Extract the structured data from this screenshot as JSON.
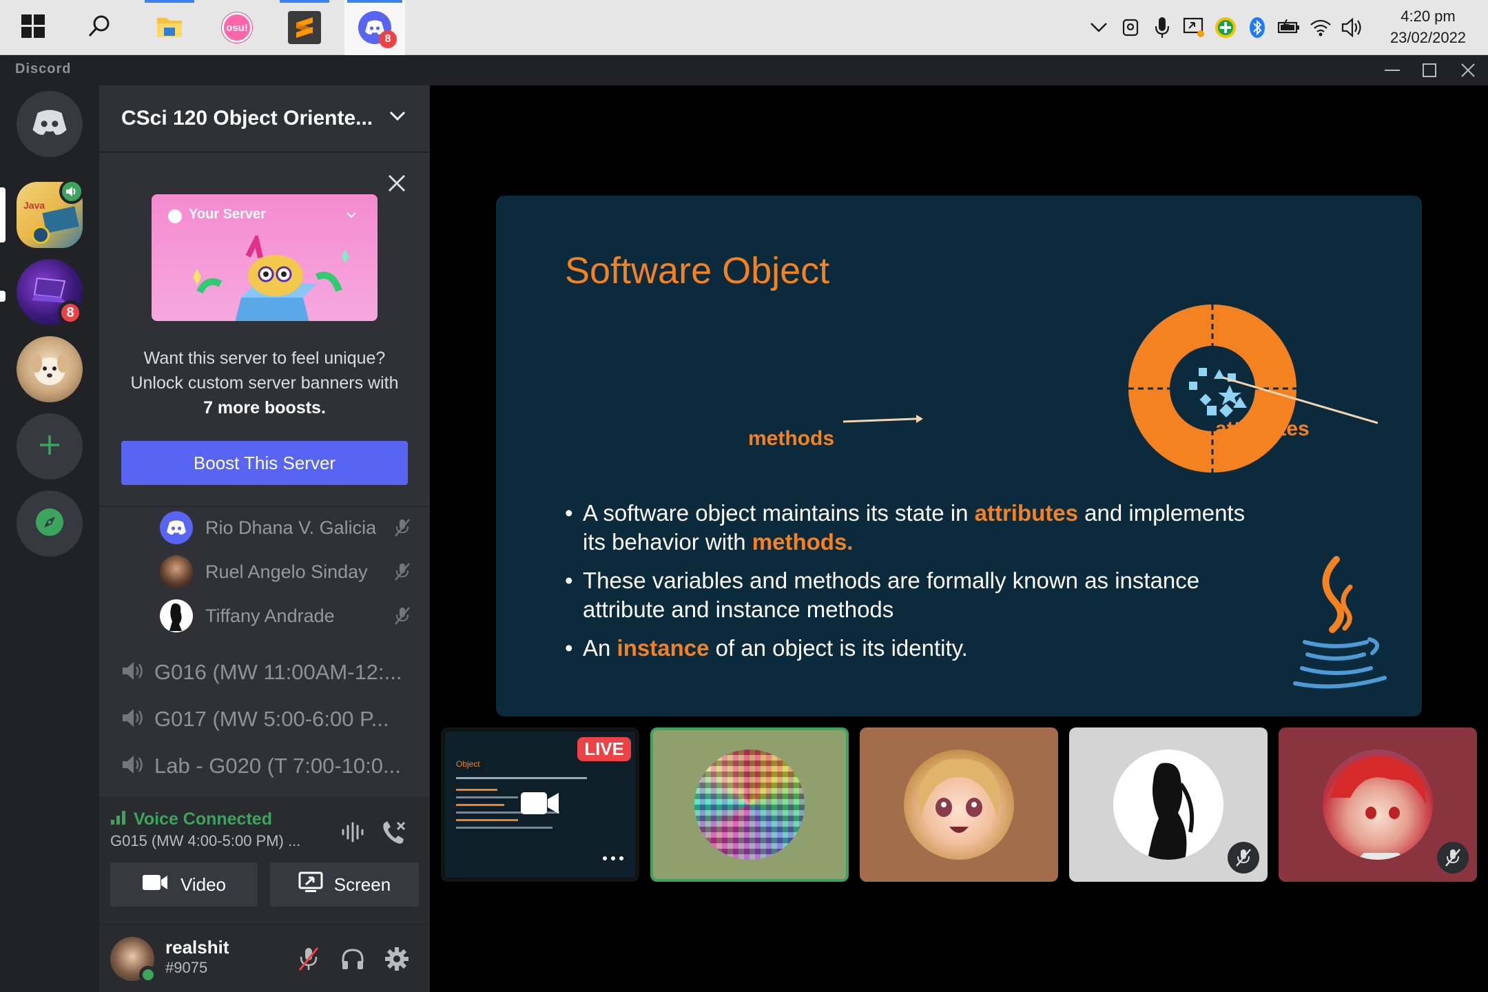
{
  "taskbar": {
    "apps": [
      {
        "name": "start-icon"
      },
      {
        "name": "search-icon"
      },
      {
        "name": "file-explorer-icon"
      },
      {
        "name": "osu-icon",
        "label": "osu!"
      },
      {
        "name": "sublime-text-icon"
      },
      {
        "name": "discord-icon",
        "badge": "8"
      }
    ],
    "clock": {
      "time": "4:20 pm",
      "date": "23/02/2022"
    }
  },
  "titlebar": {
    "brand": "Discord"
  },
  "rail": {
    "servers": [
      {
        "name": "direct-messages"
      },
      {
        "name": "server-java-class",
        "active": true,
        "speaking": true
      },
      {
        "name": "server-laptop",
        "badge": "8"
      },
      {
        "name": "server-dog"
      },
      {
        "name": "add-server"
      },
      {
        "name": "explore-servers"
      }
    ]
  },
  "sidebar": {
    "server_name": "CSci 120 Object Oriente...",
    "boost": {
      "art_label": "Your Server",
      "text_line1": "Want this server to feel unique?",
      "text_line2": "Unlock custom server banners with",
      "text_bold": "7 more boosts.",
      "button": "Boost This Server"
    },
    "voice_users": [
      {
        "name": "Rio Dhana V. Galicia"
      },
      {
        "name": "Ruel Angelo Sinday"
      },
      {
        "name": "Tiffany Andrade"
      }
    ],
    "channels": [
      {
        "name": "G016 (MW 11:00AM-12:..."
      },
      {
        "name": "G017 (MW 5:00-6:00 P..."
      },
      {
        "name": "Lab - G020 (T 7:00-10:0..."
      }
    ],
    "voice_panel": {
      "status": "Voice Connected",
      "channel": "G015 (MW 4:00-5:00 PM) ...",
      "video": "Video",
      "screen": "Screen"
    },
    "user": {
      "name": "realshit",
      "tag": "#9075"
    }
  },
  "slide": {
    "title": "Software Object",
    "label_methods": "methods",
    "label_attributes": "attributes",
    "bullets": [
      {
        "pre": "A software object maintains its state in ",
        "hl1": "attributes",
        "mid": " and implements its behavior with ",
        "hl2": "methods."
      },
      {
        "text": "These variables and methods are formally known as instance attribute and instance methods"
      },
      {
        "pre": "An ",
        "hl": "instance",
        "post": " of an object is its identity."
      }
    ]
  },
  "tiles": {
    "live_label": "LIVE",
    "stream_preview_title": "Object",
    "colors": {
      "green_ring": "#3ba55d",
      "tile2_bg": "#8fa06e",
      "tile3_bg": "#a36c4a",
      "tile4_bg": "#d4d4d4",
      "tile5_bg": "#8a3440"
    }
  }
}
